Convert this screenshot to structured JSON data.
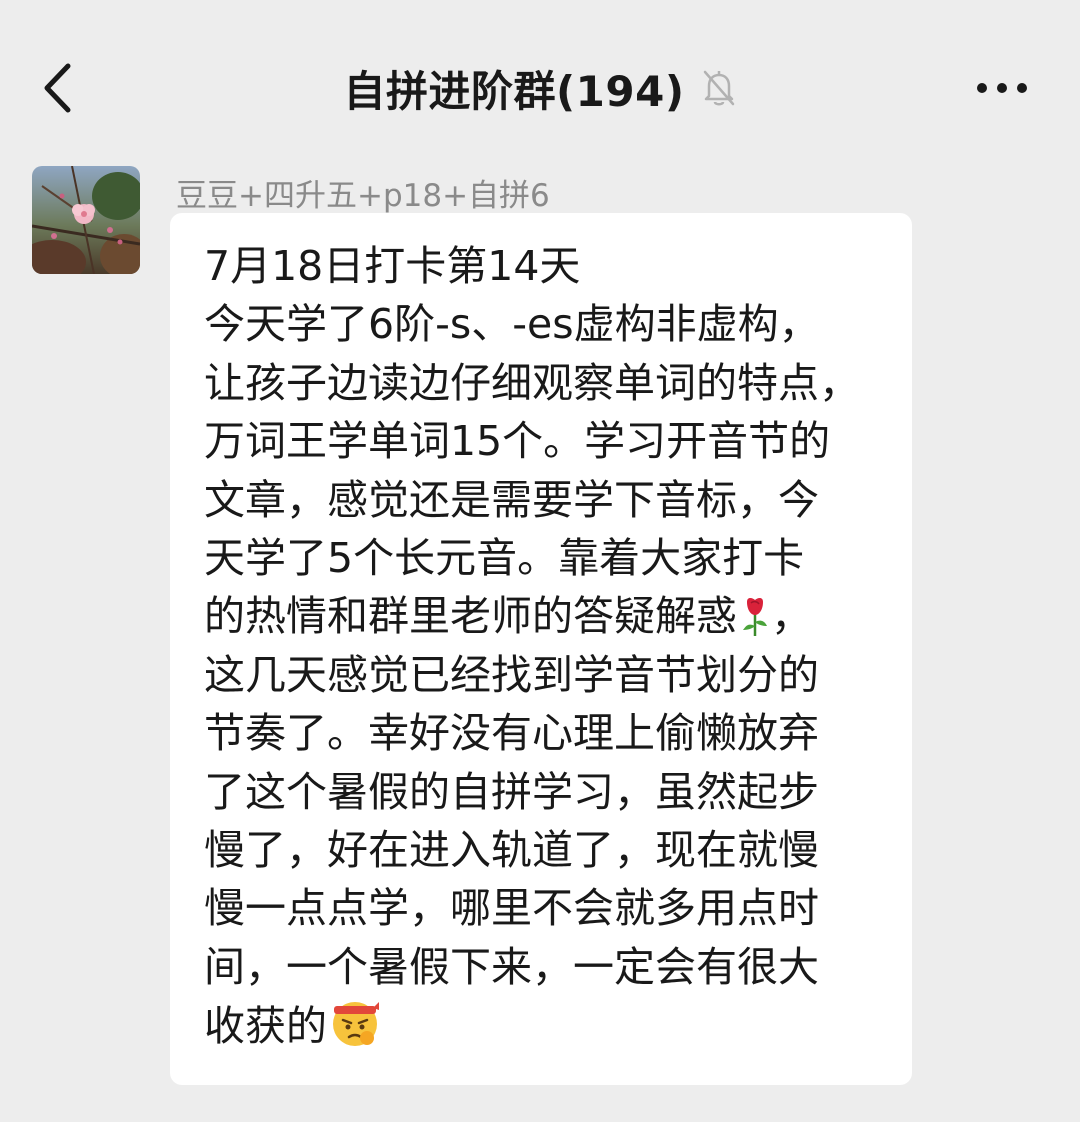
{
  "header": {
    "title": "自拼进阶群(194)",
    "back_icon": "chevron-left-icon",
    "mute_icon": "bell-muted-icon",
    "more_icon": "more-dots-icon"
  },
  "message": {
    "sender": "豆豆+四升五+p18+自拼6",
    "avatar_icon": "peach-blossom-avatar",
    "lines": [
      "7月18日打卡第14天",
      "今天学了6阶-s、-es虚构非虚构，",
      "让孩子边读边仔细观察单词的特点，",
      "万词王学单词15个。学习开音节的",
      "文章，感觉还是需要学下音标，今",
      "天学了5个长元音。靠着大家打卡",
      "的热情和群里老师的答疑解惑",
      "这几天感觉已经找到学音节划分的",
      "节奏了。幸好没有心理上偷懒放弃",
      "了这个暑假的自拼学习，虽然起步",
      "慢了，好在进入轨道了，现在就慢",
      "慢一点点学，哪里不会就多用点时",
      "间，一个暑假下来，一定会有很大",
      "收获的"
    ],
    "rose_emoji": "rose-emoji",
    "rose_suffix": "，",
    "fighting_emoji": "fighting-emoji"
  },
  "colors": {
    "background": "#ededed",
    "bubble": "#ffffff",
    "sender_text": "#8a8a8a",
    "text": "#191919"
  }
}
